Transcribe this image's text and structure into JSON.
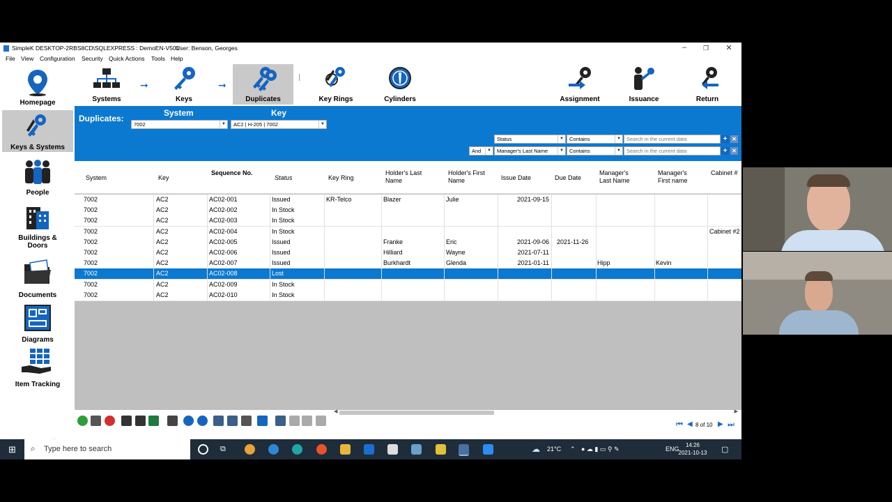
{
  "window": {
    "title": "SimpleK  DESKTOP-2RBS8CD\\SQLEXPRESS : DemoEN-V501",
    "user": "User: Benson, Georges"
  },
  "menu": [
    "File",
    "View",
    "Configuration",
    "Security",
    "Quick Actions",
    "Tools",
    "Help"
  ],
  "sidebar": [
    {
      "label": "Homepage",
      "icon": "map-pin-icon",
      "active": false
    },
    {
      "label": "Keys & Systems",
      "icon": "keys-icon",
      "active": true
    },
    {
      "label": "People",
      "icon": "people-icon",
      "active": false
    },
    {
      "label": "Buildings &\nDoors",
      "line1": "Buildings &",
      "line2": "Doors",
      "icon": "building-icon",
      "active": false
    },
    {
      "label": "Documents",
      "icon": "folder-icon",
      "active": false
    },
    {
      "label": "Diagrams",
      "icon": "diagram-icon",
      "active": false
    },
    {
      "label": "Item Tracking",
      "icon": "hand-grid-icon",
      "active": false
    }
  ],
  "toolbar": {
    "systems": "Systems",
    "keys": "Keys",
    "duplicates": "Duplicates",
    "key_rings": "Key Rings",
    "cylinders": "Cylinders",
    "assignment": "Assignment",
    "issuance": "Issuance",
    "return": "Return"
  },
  "filter": {
    "title": "Duplicates:",
    "system_header": "System",
    "key_header": "Key",
    "system_value": "7002",
    "key_value": "AC2 | H-205 | 7002",
    "row1": {
      "field": "Status",
      "op": "Contains",
      "placeholder": "Search in the current data"
    },
    "row2": {
      "logic": "And",
      "field": "Manager's Last Name",
      "op": "Contains",
      "placeholder": "Search in the current data"
    }
  },
  "columns": [
    "System",
    "Key",
    "Sequence No.",
    "Status",
    "Key Ring",
    "Holder's Last Name",
    "Holder's First Name",
    "Issue Date",
    "Due Date",
    "Manager's Last Name",
    "Manager's First name",
    "Cabinet #"
  ],
  "rows": [
    [
      "7002",
      "AC2",
      "AC02-001",
      "Issued",
      "KR-Telco",
      "Blazer",
      "Julie",
      "2021-09-15",
      "",
      "",
      "",
      ""
    ],
    [
      "7002",
      "AC2",
      "AC02-002",
      "In Stock",
      "",
      "",
      "",
      "",
      "",
      "",
      "",
      ""
    ],
    [
      "7002",
      "AC2",
      "AC02-003",
      "In Stock",
      "",
      "",
      "",
      "",
      "",
      "",
      "",
      ""
    ],
    [
      "7002",
      "AC2",
      "AC02-004",
      "In Stock",
      "",
      "",
      "",
      "",
      "",
      "",
      "",
      "Cabinet #2"
    ],
    [
      "7002",
      "AC2",
      "AC02-005",
      "Issued",
      "",
      "Franke",
      "Eric",
      "2021-09-06",
      "2021-11-26",
      "",
      "",
      ""
    ],
    [
      "7002",
      "AC2",
      "AC02-006",
      "Issued",
      "",
      "Hilliard",
      "Wayne",
      "2021-07-11",
      "",
      "",
      "",
      ""
    ],
    [
      "7002",
      "AC2",
      "AC02-007",
      "Issued",
      "",
      "Burkhardt",
      "Glenda",
      "2021-01-11",
      "",
      "Hipp",
      "Kevin",
      ""
    ],
    [
      "7002",
      "AC2",
      "AC02-008",
      "Lost",
      "",
      "",
      "",
      "",
      "",
      "",
      "",
      ""
    ],
    [
      "7002",
      "AC2",
      "AC02-009",
      "In Stock",
      "",
      "",
      "",
      "",
      "",
      "",
      "",
      ""
    ],
    [
      "7002",
      "AC2",
      "AC02-010",
      "In Stock",
      "",
      "",
      "",
      "",
      "",
      "",
      "",
      ""
    ]
  ],
  "selected_row": 7,
  "pager": {
    "text": "8 of 10"
  },
  "taskbar": {
    "search_placeholder": "Type here to search",
    "weather": "21°C",
    "lang": "ENG",
    "time": "14:26",
    "date": "2021-10-13"
  },
  "colors": {
    "accent": "#0b79d0",
    "icon_blue": "#1565c0"
  }
}
